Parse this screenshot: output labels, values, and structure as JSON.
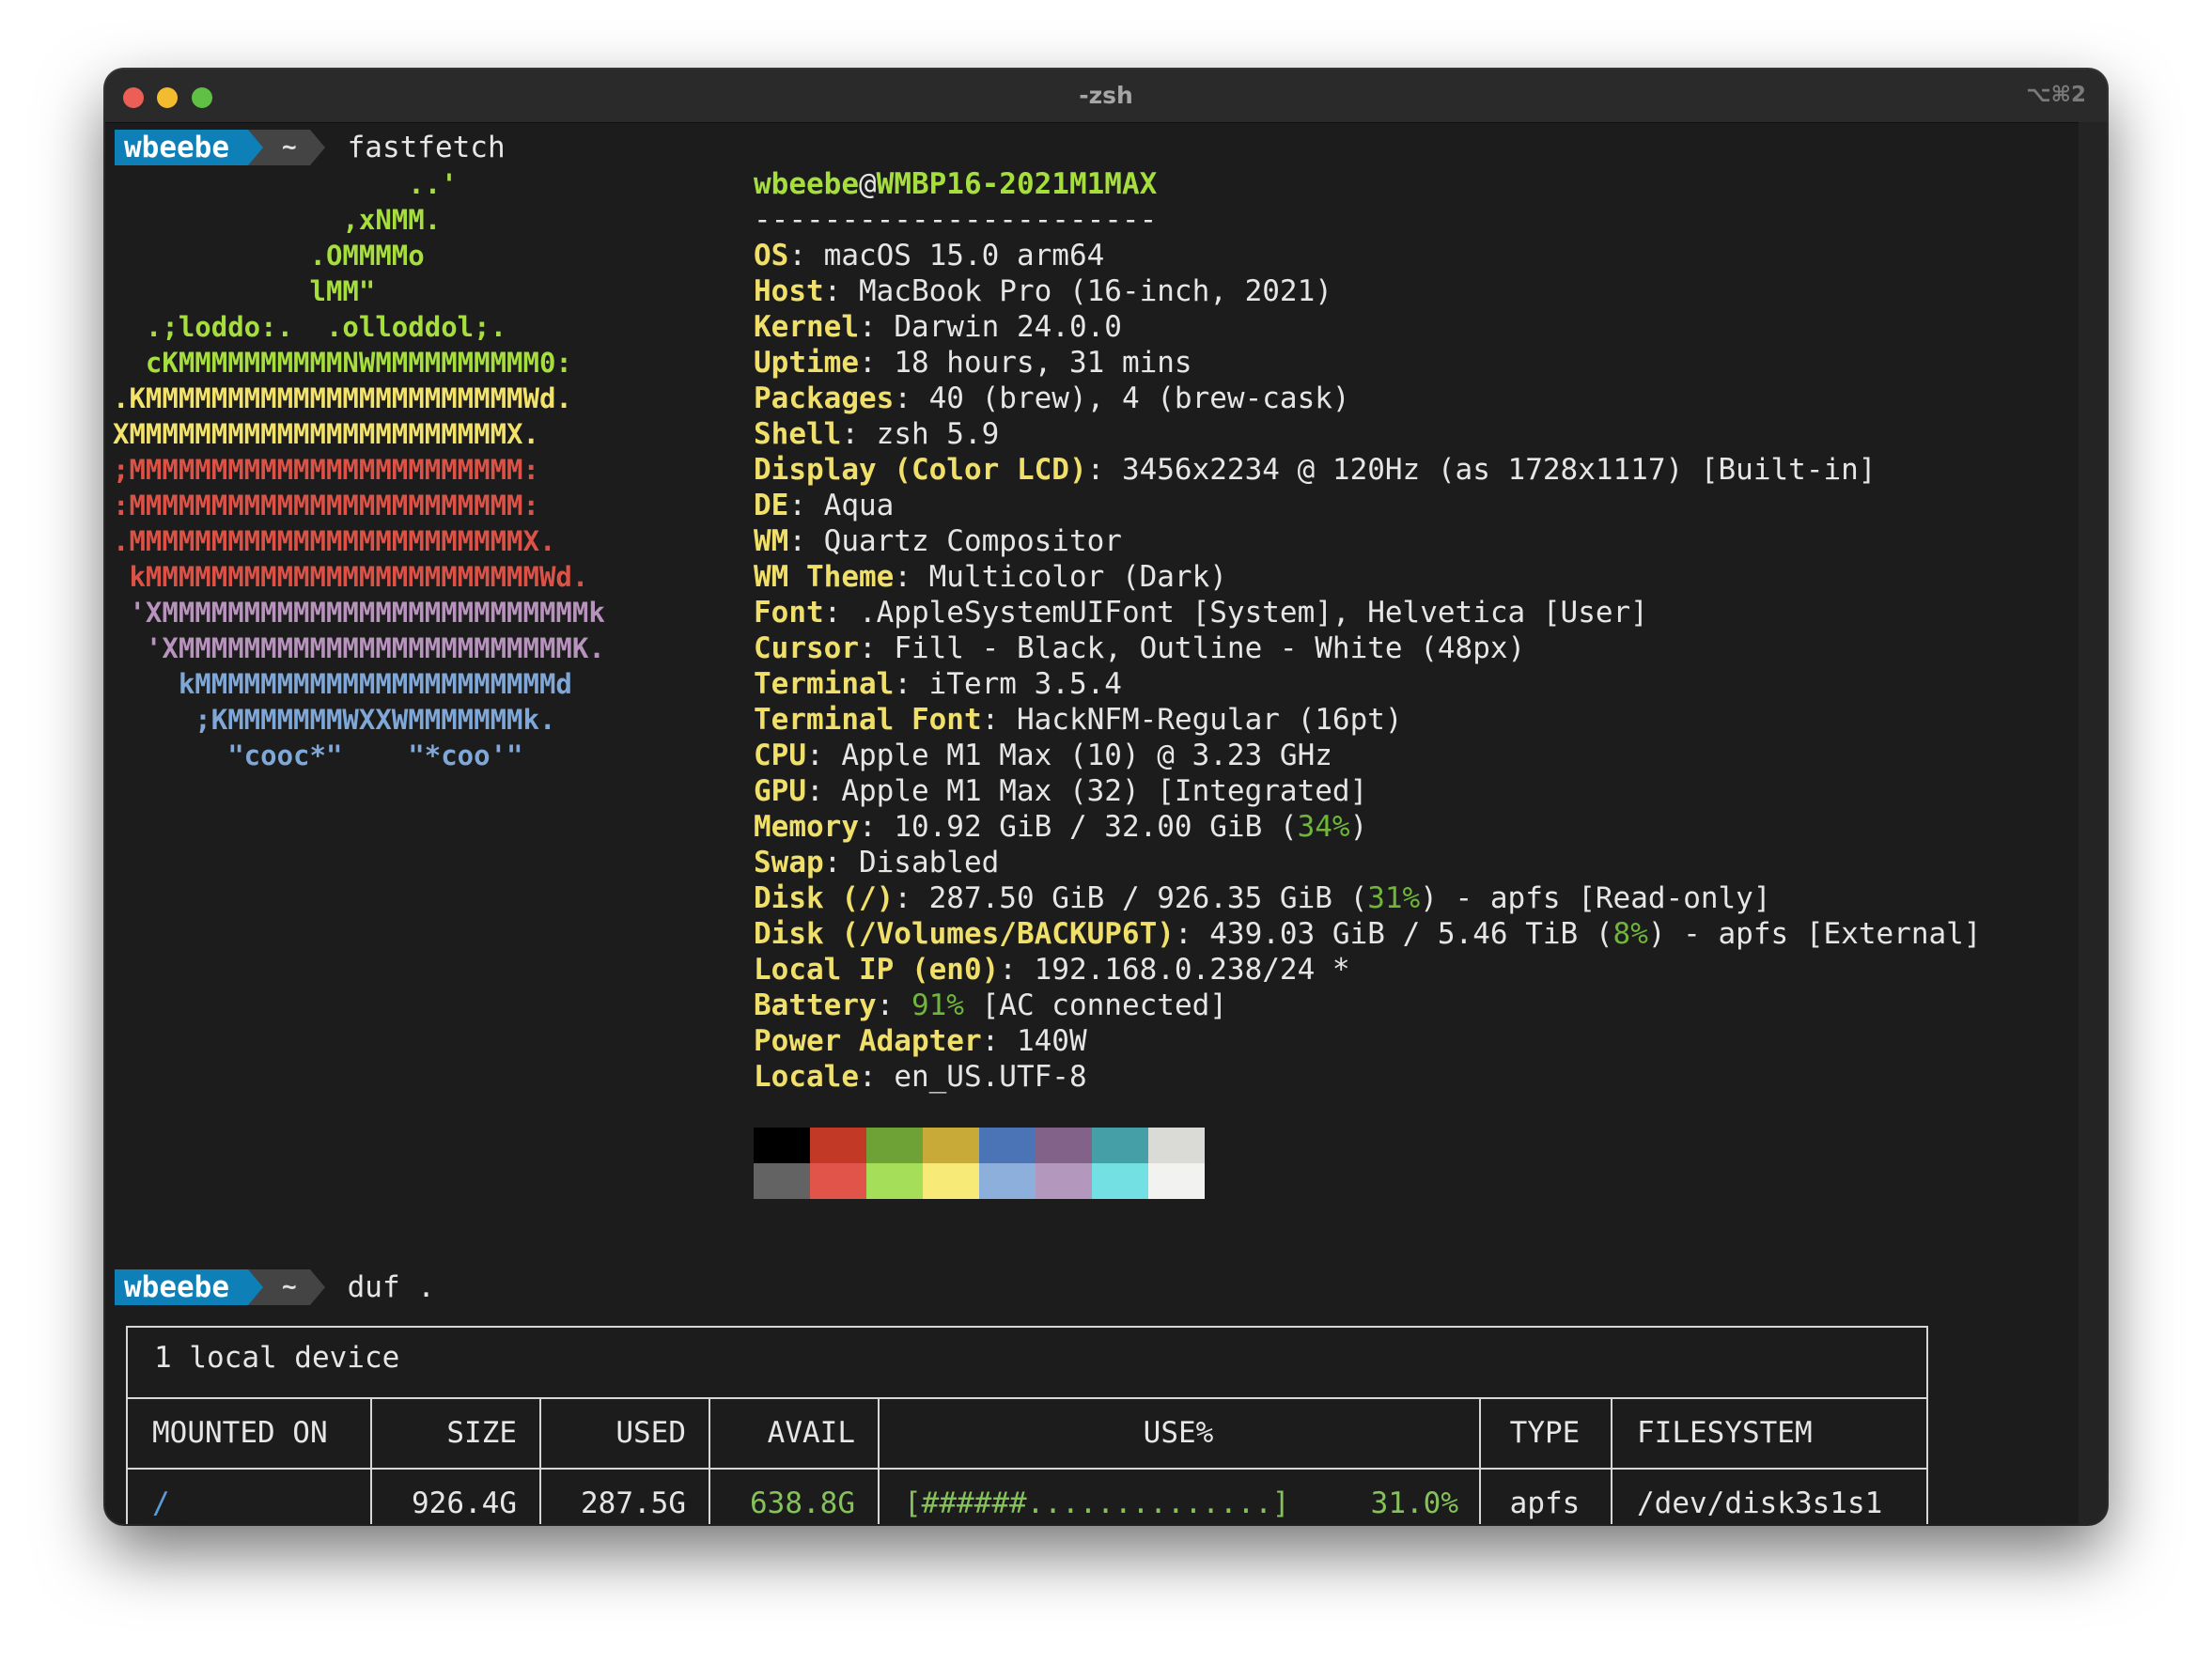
{
  "window": {
    "title": "-zsh",
    "shortcut": "⌥⌘2"
  },
  "prompt": {
    "user": "wbeebe",
    "dir": "~"
  },
  "commands": [
    "fastfetch",
    "duf ."
  ],
  "logo": [
    {
      "text": "                  ..'",
      "color": "#a5de3d"
    },
    {
      "text": "              ,xNMM.",
      "color": "#a5de3d"
    },
    {
      "text": "            .OMMMMo",
      "color": "#a5de3d"
    },
    {
      "text": "            lMM\"",
      "color": "#a5de3d"
    },
    {
      "text": "  .;loddo:.  .olloddol;.",
      "color": "#a5de3d"
    },
    {
      "text": "  cKMMMMMMMMMMNWMMMMMMMMMM0:",
      "color": "#a5de3d"
    },
    {
      "text": ".KMMMMMMMMMMMMMMMMMMMMMMMWd.",
      "color": "#f3e36b"
    },
    {
      "text": "XMMMMMMMMMMMMMMMMMMMMMMMX.",
      "color": "#f3e36b"
    },
    {
      "text": ";MMMMMMMMMMMMMMMMMMMMMMMM:",
      "color": "#dd5246"
    },
    {
      "text": ":MMMMMMMMMMMMMMMMMMMMMMMM:",
      "color": "#dd5246"
    },
    {
      "text": ".MMMMMMMMMMMMMMMMMMMMMMMMX.",
      "color": "#dd5246"
    },
    {
      "text": " kMMMMMMMMMMMMMMMMMMMMMMMMWd.",
      "color": "#dd5246"
    },
    {
      "text": " 'XMMMMMMMMMMMMMMMMMMMMMMMMMMk",
      "color": "#b893bd"
    },
    {
      "text": "  'XMMMMMMMMMMMMMMMMMMMMMMMMK.",
      "color": "#b893bd"
    },
    {
      "text": "    kMMMMMMMMMMMMMMMMMMMMMMd",
      "color": "#7fa8d8"
    },
    {
      "text": "     ;KMMMMMMMWXXWMMMMMMMk.",
      "color": "#7fa8d8"
    },
    {
      "text": "       \"cooc*\"    \"*coo'\"",
      "color": "#7fa8d8"
    }
  ],
  "info": {
    "user": "wbeebe",
    "host": "WMBP16-2021M1MAX",
    "separator": "-----------------------",
    "rows": [
      {
        "key": "OS",
        "value": "macOS 15.0 arm64"
      },
      {
        "key": "Host",
        "value": "MacBook Pro (16-inch, 2021)"
      },
      {
        "key": "Kernel",
        "value": "Darwin 24.0.0"
      },
      {
        "key": "Uptime",
        "value": "18 hours, 31 mins"
      },
      {
        "key": "Packages",
        "value": "40 (brew), 4 (brew-cask)"
      },
      {
        "key": "Shell",
        "value": "zsh 5.9"
      },
      {
        "key": "Display (Color LCD)",
        "value": "3456x2234 @ 120Hz (as 1728x1117) [Built-in]"
      },
      {
        "key": "DE",
        "value": "Aqua"
      },
      {
        "key": "WM",
        "value": "Quartz Compositor"
      },
      {
        "key": "WM Theme",
        "value": "Multicolor (Dark)"
      },
      {
        "key": "Font",
        "value": ".AppleSystemUIFont [System], Helvetica [User]"
      },
      {
        "key": "Cursor",
        "value": "Fill - Black, Outline - White (48px)"
      },
      {
        "key": "Terminal",
        "value": "iTerm 3.5.4"
      },
      {
        "key": "Terminal Font",
        "value": "HackNFM-Regular (16pt)"
      },
      {
        "key": "CPU",
        "value": "Apple M1 Max (10) @ 3.23 GHz"
      },
      {
        "key": "GPU",
        "value": "Apple M1 Max (32) [Integrated]"
      },
      {
        "key": "Memory",
        "value": "10.92 GiB / 32.00 GiB (",
        "pct": "34%",
        "suffix": ")"
      },
      {
        "key": "Swap",
        "value": "Disabled"
      },
      {
        "key": "Disk (/)",
        "value": "287.50 GiB / 926.35 GiB (",
        "pct": "31%",
        "suffix": ") - apfs [Read-only]"
      },
      {
        "key": "Disk (/Volumes/BACKUP6T)",
        "value": "439.03 GiB / 5.46 TiB (",
        "pct": "8%",
        "suffix": ") - apfs [External]"
      },
      {
        "key": "Local IP (en0)",
        "value": "192.168.0.238/24 *"
      },
      {
        "key": "Battery",
        "value": "",
        "pct": "91%",
        "suffix": " [AC connected]"
      },
      {
        "key": "Power Adapter",
        "value": "140W"
      },
      {
        "key": "Locale",
        "value": "en_US.UTF-8"
      }
    ]
  },
  "palette": {
    "normal": [
      "#000000",
      "#c23a25",
      "#6ea136",
      "#c7aa38",
      "#4a74b5",
      "#83628a",
      "#44a0a6",
      "#dadbd6"
    ],
    "bright": [
      "#636363",
      "#e0544a",
      "#a5de58",
      "#f7ea76",
      "#8cb0db",
      "#b497bd",
      "#73e0e4",
      "#f2f2f0"
    ]
  },
  "duf": {
    "caption": "1 local device",
    "headers": [
      "MOUNTED ON",
      "SIZE",
      "USED",
      "AVAIL",
      "USE%",
      "TYPE",
      "FILESYSTEM"
    ],
    "row": {
      "mounted": "/",
      "size": "926.4G",
      "used": "287.5G",
      "avail": "638.8G",
      "bar": "[######..............]",
      "use_pct": "31.0%",
      "type": "apfs",
      "filesystem": "/dev/disk3s1s1"
    }
  }
}
